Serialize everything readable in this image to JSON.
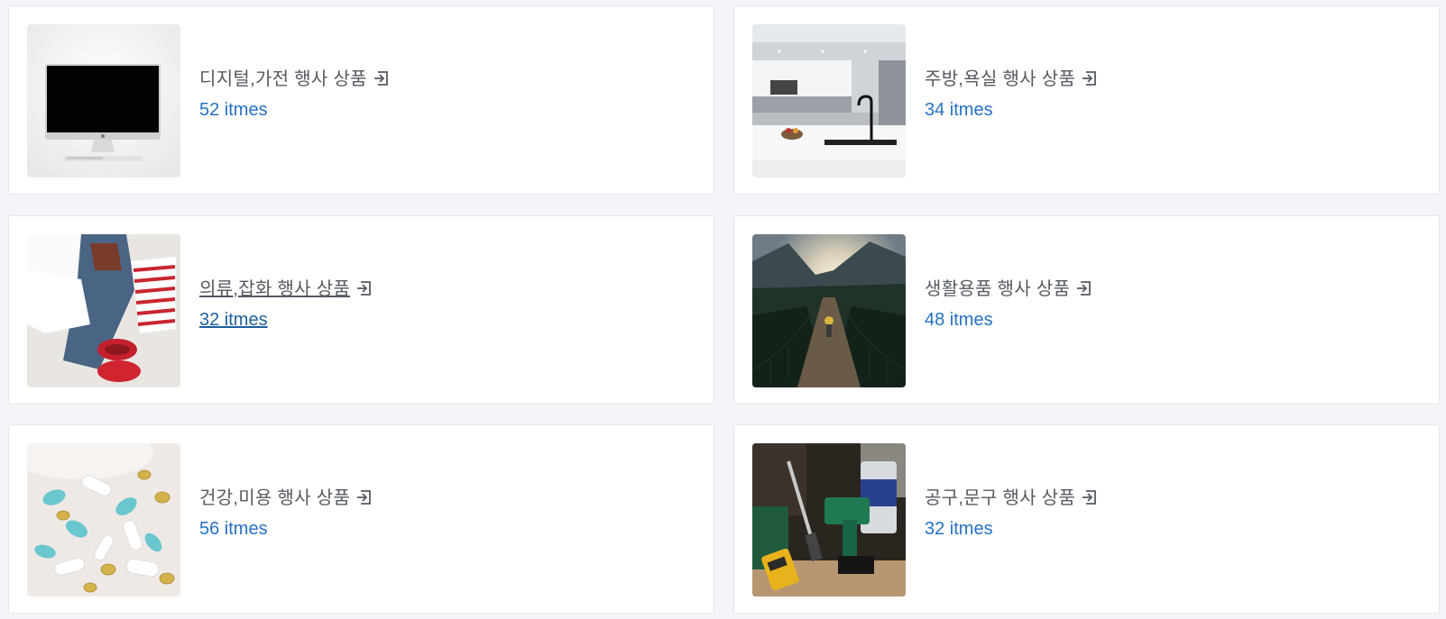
{
  "categories": [
    {
      "title": "디지털,가전 행사 상품",
      "count": "52 itmes",
      "image": "imac-monitor"
    },
    {
      "title": "주방,욕실 행사 상품",
      "count": "34 itmes",
      "image": "white-kitchen"
    },
    {
      "title": "의류,잡화 행사 상품",
      "count": "32 itmes",
      "image": "folded-clothes-shoes"
    },
    {
      "title": "생활용품 행사 상품",
      "count": "48 itmes",
      "image": "suspension-bridge-mountains"
    },
    {
      "title": "건강,미용 행사 상품",
      "count": "56 itmes",
      "image": "pills-capsules"
    },
    {
      "title": "공구,문구 행사 상품",
      "count": "32 itmes",
      "image": "power-tools"
    }
  ],
  "icons": {
    "enter": "enter-arrow-icon"
  },
  "colors": {
    "title": "#555a60",
    "count": "#2670c4",
    "card_bg": "#ffffff",
    "page_bg": "#f4f5f8"
  }
}
